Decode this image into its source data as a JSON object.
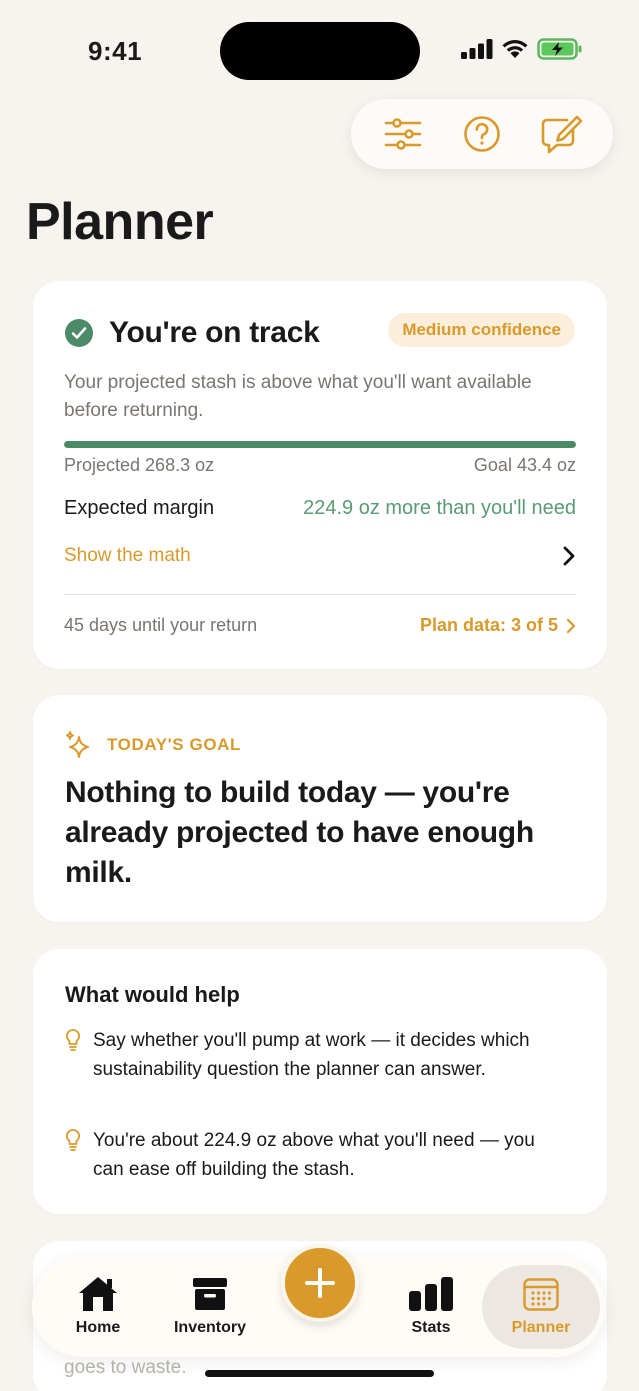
{
  "status_bar": {
    "time": "9:41"
  },
  "toolbar": {
    "filters_icon": "sliders-icon",
    "help_icon": "question-circle-icon",
    "compose_icon": "compose-icon"
  },
  "page": {
    "title": "Planner"
  },
  "status_card": {
    "title": "You're on track",
    "confidence": "Medium confidence",
    "subtitle": "Your projected stash is above what you'll want available before returning.",
    "progress_fraction": 1.0,
    "projected": "Projected 268.3 oz",
    "goal": "Goal 43.4 oz",
    "margin_label": "Expected margin",
    "margin_value": "224.9 oz more than you'll need",
    "show_math": "Show the math",
    "days_until_return": "45 days until your return",
    "plan_data": "Plan data: 3 of 5"
  },
  "goal_card": {
    "label": "TODAY'S GOAL",
    "text": "Nothing to build today — you're already projected to have enough milk."
  },
  "help_card": {
    "title": "What would help",
    "items": [
      "Say whether you'll pump at work — it decides which sustainability question the planner can answer.",
      "You're about 224.9 oz above what you'll need — you can ease off building the stash."
    ]
  },
  "peek_card": {
    "trailing_text": "goes to waste."
  },
  "tab_bar": {
    "tabs": [
      {
        "label": "Home",
        "icon": "home-icon"
      },
      {
        "label": "Inventory",
        "icon": "archive-box-icon"
      },
      {
        "label": "Stats",
        "icon": "bar-chart-icon"
      },
      {
        "label": "Planner",
        "icon": "calendar-icon",
        "selected": true
      }
    ],
    "add_button_icon": "plus-icon"
  },
  "colors": {
    "accent": "#d99a2b",
    "success": "#4a8a67",
    "background": "#f7f4ef",
    "card": "#ffffff"
  }
}
